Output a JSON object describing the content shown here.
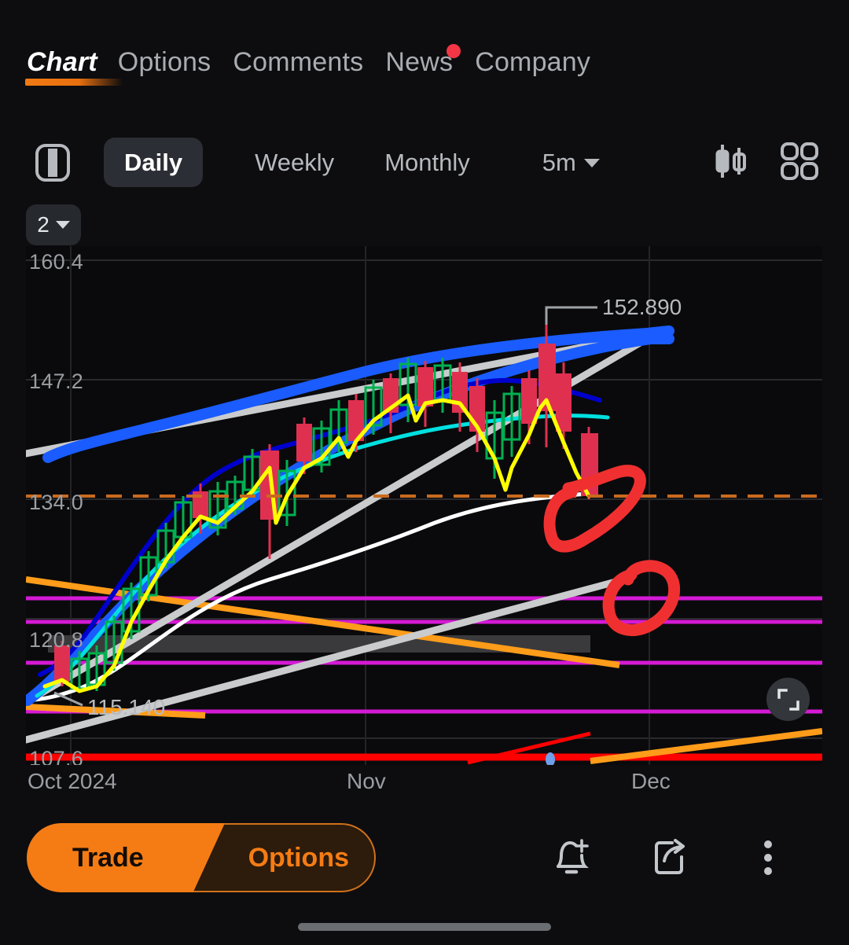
{
  "nav": {
    "tabs": [
      {
        "label": "Chart",
        "active": true,
        "badge": false
      },
      {
        "label": "Options",
        "active": false,
        "badge": false
      },
      {
        "label": "Comments",
        "active": false,
        "badge": false
      },
      {
        "label": "News",
        "active": false,
        "badge": true
      },
      {
        "label": "Company",
        "active": false,
        "badge": false
      }
    ]
  },
  "toolbar": {
    "panel_icon": "chart-layout-icon",
    "timeframes": [
      {
        "label": "Daily",
        "active": true
      },
      {
        "label": "Weekly",
        "active": false
      },
      {
        "label": "Monthly",
        "active": false
      }
    ],
    "interval": {
      "label": "5m",
      "caret": "chevron-down-icon"
    },
    "candle_icon": "candlestick-icon",
    "grid_icon": "layout-grid-icon"
  },
  "indicator_count": {
    "label": "2",
    "caret": "chevron-down-icon"
  },
  "fullscreen": {
    "icon": "expand-icon"
  },
  "bottom_bar": {
    "trade_label": "Trade",
    "options_label": "Options",
    "alert_icon": "bell-plus-icon",
    "share_icon": "share-icon",
    "more_icon": "more-vertical-icon"
  },
  "colors": {
    "background": "#0d0d0f",
    "chart_background": "#0a0a0c",
    "accent_orange": "#f57c14",
    "badge_red": "#f23645",
    "up_candle": "#00b050",
    "down_candle": "#e03050",
    "ma_yellow": "#ffff00",
    "ma_navy": "#0000cd",
    "ma_cyan": "#00e0e0",
    "ma_white": "#ffffff",
    "band_blue": "#1a5cff",
    "trend_gray": "#c9cbcd",
    "trend_orange": "#ff9c1a",
    "level_magenta": "#d51ad5",
    "level_red": "#ff0000",
    "dashed_orange": "#c96a1e",
    "annotation_red": "#f03030",
    "grid_line": "#2a2a2d",
    "axis_text": "#9a9da2"
  },
  "chart_data": {
    "type": "line",
    "title": "",
    "xlabel": "",
    "ylabel": "",
    "grid": true,
    "legend": "none",
    "y_ticks": [
      160.4,
      147.2,
      134.0,
      120.8,
      107.6
    ],
    "y_tick_labels": [
      "160.4",
      "147.2",
      "134.0",
      "120.8",
      "107.6"
    ],
    "ylim": [
      104.3,
      163.7
    ],
    "x_ticks": [
      "Oct 2024",
      "Nov",
      "Dec"
    ],
    "x_tick_labels": [
      "Oct 2024",
      "Nov",
      "Dec"
    ],
    "annotations": [
      {
        "text": "152.890",
        "kind": "price-callout",
        "x_frac": 0.72,
        "y_value": 152.89
      },
      {
        "text": "115.140",
        "kind": "price-callout",
        "x_frac": 0.08,
        "y_value": 115.14
      }
    ],
    "drawn_marks": [
      {
        "kind": "hand-drawn-circle",
        "color": "#f03030",
        "x_frac": 0.74,
        "y_value": 130.5
      },
      {
        "kind": "hand-drawn-circle",
        "color": "#f03030",
        "x_frac": 0.79,
        "y_value": 121.0
      }
    ],
    "series": [
      {
        "name": "candles",
        "type": "candlestick",
        "up_color": "#00b050",
        "down_color": "#e03050",
        "ohlc": [
          [
            120.5,
            122.0,
            117.0,
            118.2
          ],
          [
            118.2,
            120.0,
            116.2,
            119.4
          ],
          [
            119.4,
            121.0,
            117.6,
            117.9
          ],
          [
            117.9,
            120.8,
            116.8,
            120.2
          ],
          [
            120.2,
            124.5,
            119.4,
            123.8
          ],
          [
            123.8,
            127.0,
            122.5,
            126.4
          ],
          [
            126.4,
            130.5,
            125.6,
            129.8
          ],
          [
            129.8,
            132.5,
            128.6,
            131.6
          ],
          [
            131.6,
            134.8,
            130.4,
            133.2
          ],
          [
            133.2,
            135.0,
            131.2,
            131.8
          ],
          [
            131.8,
            134.6,
            130.6,
            133.9
          ],
          [
            133.9,
            136.4,
            132.8,
            135.6
          ],
          [
            135.6,
            137.2,
            134.3,
            136.0
          ],
          [
            136.0,
            139.6,
            135.0,
            138.8
          ],
          [
            138.8,
            140.0,
            130.6,
            131.2
          ],
          [
            131.2,
            136.6,
            130.2,
            135.8
          ],
          [
            135.8,
            139.0,
            134.6,
            138.4
          ],
          [
            138.4,
            141.2,
            137.2,
            139.8
          ],
          [
            139.8,
            141.0,
            138.2,
            139.2
          ],
          [
            139.2,
            143.2,
            138.6,
            142.6
          ],
          [
            142.6,
            146.8,
            141.8,
            145.9
          ],
          [
            145.9,
            147.6,
            143.0,
            143.6
          ],
          [
            143.6,
            145.4,
            142.2,
            144.4
          ],
          [
            144.4,
            146.2,
            143.2,
            145.6
          ],
          [
            145.6,
            147.8,
            144.4,
            147.0
          ],
          [
            147.0,
            148.4,
            143.6,
            144.2
          ],
          [
            144.2,
            146.0,
            142.0,
            142.8
          ],
          [
            142.8,
            144.8,
            138.0,
            139.0
          ],
          [
            139.0,
            142.6,
            137.2,
            141.8
          ],
          [
            141.8,
            144.0,
            140.0,
            143.2
          ],
          [
            143.2,
            152.89,
            142.0,
            144.0
          ],
          [
            144.0,
            145.6,
            139.0,
            139.6
          ],
          [
            139.6,
            141.0,
            131.6,
            132.0
          ]
        ]
      },
      {
        "name": "price-ma-yellow",
        "type": "line",
        "color": "#ffff00",
        "width": 4,
        "values": [
          118.6,
          118.0,
          118.4,
          120.0,
          124.0,
          127.0,
          130.0,
          131.8,
          133.6,
          132.2,
          134.2,
          135.8,
          136.4,
          139.2,
          132.0,
          136.2,
          138.6,
          140.0,
          139.4,
          142.8,
          146.2,
          143.8,
          144.6,
          145.8,
          147.2,
          144.4,
          143.0,
          139.2,
          142.0,
          143.4,
          144.4,
          140.0,
          132.4
        ]
      },
      {
        "name": "ma-navy",
        "type": "line",
        "color": "#0000cd",
        "width": 5,
        "values": [
          116.6,
          116.4,
          116.4,
          116.6,
          117.2,
          118.2,
          119.6,
          121.4,
          123.4,
          125.2,
          127.0,
          128.8,
          130.4,
          132.0,
          133.0,
          134.0,
          135.2,
          136.6,
          137.6,
          138.8,
          140.2,
          141.0,
          141.8,
          142.6,
          143.4,
          143.8,
          143.8,
          143.4,
          143.2,
          143.4,
          143.8,
          143.6,
          142.8
        ]
      },
      {
        "name": "ma-cyan",
        "type": "line",
        "color": "#00e0e0",
        "width": 4,
        "values": [
          115.4,
          115.0,
          114.8,
          114.8,
          115.0,
          115.6,
          116.6,
          117.8,
          119.2,
          120.8,
          122.4,
          124.0,
          125.6,
          127.2,
          128.4,
          129.6,
          130.8,
          132.0,
          133.0,
          134.2,
          135.4,
          136.2,
          137.0,
          137.8,
          138.6,
          139.2,
          139.6,
          139.8,
          140.0,
          140.4,
          140.8,
          141.0,
          140.8
        ]
      },
      {
        "name": "ma-white",
        "type": "line",
        "color": "#ffffff",
        "width": 4,
        "values": [
          114.0,
          113.4,
          113.0,
          112.8,
          112.8,
          113.0,
          113.4,
          114.0,
          114.8,
          115.6,
          116.4,
          117.2,
          118.2,
          119.2,
          120.2,
          121.4,
          122.6,
          123.8,
          125.0,
          126.2,
          127.4,
          128.4,
          129.2,
          130.0,
          130.6,
          131.0,
          131.4,
          131.6,
          131.8,
          132.0,
          132.1,
          132.2,
          132.2
        ]
      },
      {
        "name": "channel-upper-blue",
        "type": "band",
        "color": "#1a5cff",
        "width": 12
      },
      {
        "name": "channel-lower-blue",
        "type": "band",
        "color": "#1a5cff",
        "width": 12
      },
      {
        "name": "trendline-gray-upper",
        "type": "trendline",
        "color": "#c9cbcd",
        "width": 8
      },
      {
        "name": "trendline-gray-lower",
        "type": "trendline",
        "color": "#c9cbcd",
        "width": 8
      },
      {
        "name": "trendline-orange-down",
        "type": "trendline",
        "color": "#ff9c1a",
        "width": 7
      },
      {
        "name": "trendline-orange-flat",
        "type": "trendline",
        "color": "#ff9c1a",
        "width": 7
      },
      {
        "name": "trendline-orange-up",
        "type": "trendline",
        "color": "#ff9c1a",
        "width": 7
      },
      {
        "name": "trendline-red-short",
        "type": "trendline",
        "color": "#ff0000",
        "width": 5
      }
    ],
    "horizontal_levels": [
      {
        "color": "#d51ad5",
        "y_value": 124.6,
        "width": 5
      },
      {
        "color": "#d51ad5",
        "y_value": 122.2,
        "width": 5
      },
      {
        "color": "#d51ad5",
        "y_value": 118.6,
        "width": 5
      },
      {
        "color": "#d51ad5",
        "y_value": 114.0,
        "width": 5
      },
      {
        "color": "#ff0000",
        "y_value": 107.8,
        "width": 8
      },
      {
        "color": "#c96a1e",
        "y_value": 130.6,
        "width": 4,
        "style": "dashed"
      }
    ]
  }
}
